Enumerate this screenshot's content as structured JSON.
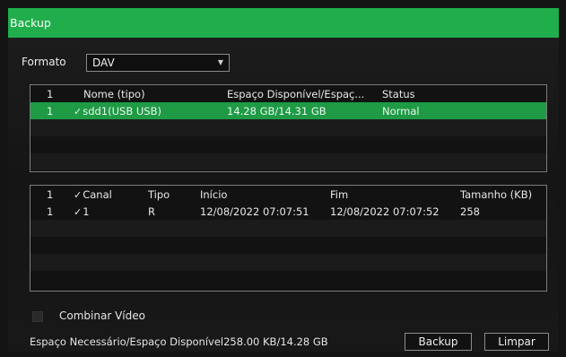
{
  "window": {
    "title": "Backup"
  },
  "format": {
    "label": "Formato",
    "value": "DAV"
  },
  "devices_table": {
    "headers": [
      "1",
      "Nome (tipo)",
      "Espaço Disponível/Espaç...",
      "Status"
    ],
    "rows": [
      {
        "index": "1",
        "checked": true,
        "name": "sdd1(USB USB)",
        "space": "14.28 GB/14.31 GB",
        "status": "Normal"
      }
    ]
  },
  "files_table": {
    "headers": [
      "1",
      "Canal",
      "Tipo",
      "Início",
      "Fim",
      "Tamanho (KB)"
    ],
    "rows": [
      {
        "index": "1",
        "checked": true,
        "channel": "1",
        "type": "R",
        "start": "12/08/2022 07:07:51",
        "end": "12/08/2022 07:07:52",
        "size": "258"
      }
    ]
  },
  "combine": {
    "label": "Combinar Vídeo",
    "checked": false
  },
  "footer": {
    "space_text": "Espaço Necessário/Espaço Disponível258.00 KB/14.28 GB",
    "backup_label": "Backup",
    "clear_label": "Limpar"
  },
  "colors": {
    "accent": "#1fae4b",
    "selected_row": "#1f9a45"
  },
  "icons": {
    "checkmark": "checkmark-icon",
    "dropdown": "chevron-down-icon"
  }
}
